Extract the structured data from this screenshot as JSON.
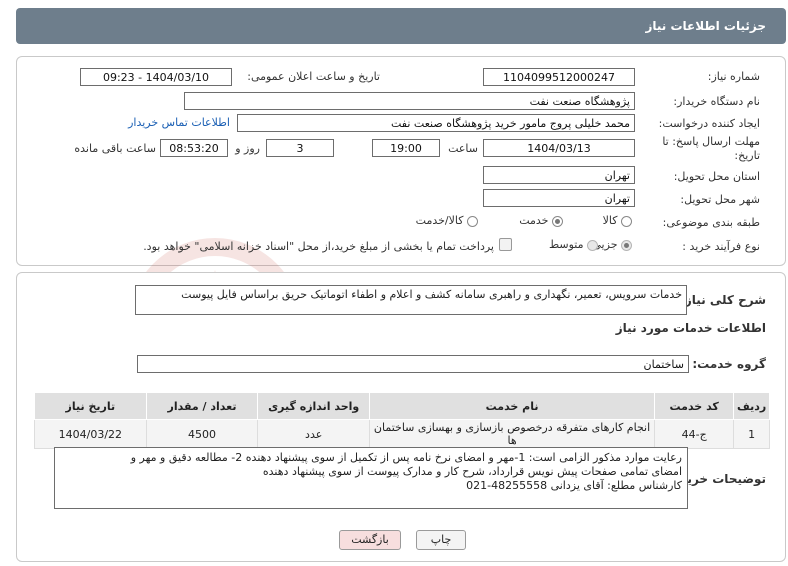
{
  "header": {
    "title": "جزئیات اطلاعات نیاز"
  },
  "form": {
    "need_number_label": "شماره نیاز:",
    "need_number": "1104099512000247",
    "announce_label": "تاریخ و ساعت اعلان عمومی:",
    "announce_value": "1404/03/10 - 09:23",
    "buyer_org_label": "نام دستگاه خریدار:",
    "buyer_org": "پژوهشگاه صنعت نفت",
    "creator_label": "ایجاد کننده درخواست:",
    "creator": "محمد خلیلی پروج مامور خرید پژوهشگاه صنعت نفت",
    "contact_link": "اطلاعات تماس خریدار",
    "deadline_label_1": "مهلت ارسال پاسخ: تا",
    "deadline_label_2": "تاریخ:",
    "deadline_date": "1404/03/13",
    "time_label": "ساعت",
    "deadline_time": "19:00",
    "days_value": "3",
    "days_label": "روز و",
    "remaining_time": "08:53:20",
    "remaining_label": "ساعت باقی مانده",
    "province_label": "استان محل تحویل:",
    "province": "تهران",
    "city_label": "شهر محل تحویل:",
    "city": "تهران",
    "category_label": "طبقه بندی موضوعی:",
    "category_options": [
      "کالا",
      "خدمت",
      "کالا/خدمت"
    ],
    "category_selected": "خدمت",
    "process_label": "نوع فرآیند خرید :",
    "process_options": [
      "جزیی",
      "متوسط"
    ],
    "process_selected": "جزیی",
    "payment_note": "پرداخت تمام یا بخشی از مبلغ خرید،از محل \"اسناد خزانه اسلامی\" خواهد بود."
  },
  "summary": {
    "label": "شرح کلی نیاز:",
    "text": "خدمات سرویس، تعمیر، نگهداری و راهبری سامانه کشف و اعلام و اطفاء اتوماتیک حریق براساس فایل پیوست"
  },
  "services": {
    "section_title": "اطلاعات خدمات مورد نیاز",
    "group_label": "گروه خدمت:",
    "group_value": "ساختمان",
    "columns": [
      "ردیف",
      "کد خدمت",
      "نام خدمت",
      "واحد اندازه گیری",
      "تعداد / مقدار",
      "تاریخ نیاز"
    ],
    "rows": [
      [
        "1",
        "ج-44",
        "انجام کارهای متفرقه درخصوص بازسازی و بهسازی ساختمان ها",
        "عدد",
        "4500",
        "1404/03/22"
      ]
    ]
  },
  "buyer_notes": {
    "label": "توضیحات خریدار:",
    "lines": [
      "رعایت موارد مذکور الزامی است: 1-مهر و امضای نرخ نامه پس از تکمیل از سوی پیشنهاد دهنده 2- مطالعه دقیق و مهر و",
      "امضای تمامی صفحات پیش نویس قرارداد، شرح کار و مدارک پیوست از سوی پیشنهاد دهنده",
      "کارشناس مطلع: آقای یزدانی 48255558-021"
    ]
  },
  "buttons": {
    "print": "چاپ",
    "back": "بازگشت"
  },
  "watermark": {
    "text": "AriaTender.net"
  },
  "colors": {
    "header_bg": "#6e7e8c",
    "link": "#1a5fb4",
    "back_button_bg": "#f7dede",
    "watermark": "#c0392b"
  }
}
